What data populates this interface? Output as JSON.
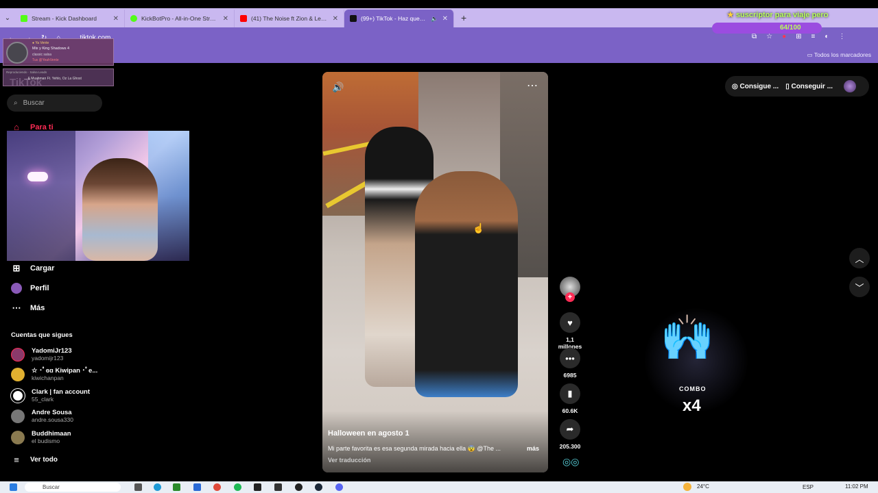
{
  "browser": {
    "tabs": [
      {
        "title": "Stream - Kick Dashboard",
        "color": "#53fc18"
      },
      {
        "title": "KickBotPro - All-in-One Stream...",
        "color": "#53fc18"
      },
      {
        "title": "(41) The Noise ft Zion & Lennox ...",
        "color": "#ff0000"
      },
      {
        "title": "(99+) TikTok - Haz que tu d...",
        "color": "#111111"
      }
    ],
    "new_tab": "+",
    "url": "tiktok.com",
    "bookmarks_all": "Todos los marcadores"
  },
  "overlay": {
    "sub_goal": "suscriptor para viaje pero",
    "goal_progress": "64/100",
    "music_l1": "● Ya Vente",
    "music_l2": "Mix y King Shadows 4",
    "music_l3": "classic salsa",
    "music_l4": "Tus @YeahVente",
    "music2_l1": "Reproduciendo · Salsa Leads",
    "music2_l2": "... & Mushman Ft. Yehlo, Oz La Ghost",
    "combo_label": "COMBO",
    "combo_count": "x4"
  },
  "sidebar": {
    "logo": "TikTok",
    "search_placeholder": "Buscar",
    "nav": {
      "for_you": "Para ti",
      "upload": "Cargar",
      "profile": "Perfil",
      "more": "Más"
    },
    "following_title": "Cuentas que sigues",
    "following": [
      {
        "name": "YadomiJr123",
        "handle": "yadomijr123",
        "color": "#8a3a6a"
      },
      {
        "name": "☆ ･ﾟɞɑ Kiwipan ･ﾟe...",
        "handle": "kiwichanpan",
        "color": "#e0b030"
      },
      {
        "name": "Clark | fan account",
        "handle": "55_clark",
        "color": "#ffffff"
      },
      {
        "name": "Andre Sousa",
        "handle": "andre.sousa330",
        "color": "#777777"
      },
      {
        "name": "Buddhimaan",
        "handle": "el budismo",
        "color": "#8a7a50"
      }
    ],
    "see_all": "Ver todo"
  },
  "video": {
    "title": "Halloween en agosto 1",
    "description": "Mi parte favorita es esa segunda mirada hacia ella 😨 @The ...",
    "more": "más",
    "translate": "Ver traducción"
  },
  "actions": {
    "likes": "1,1 millones",
    "comments": "6985",
    "saves": "60.6K",
    "shares": "205.300"
  },
  "topbar": {
    "get_coins": "Consigue ...",
    "get_app": "Conseguir ..."
  },
  "taskbar": {
    "search": "Buscar",
    "weather": "24°C",
    "lang": "ESP",
    "time": "11:02 PM"
  },
  "colors": {
    "accent": "#fe2c55",
    "chrome": "#7b62c6",
    "goal_text": "#b8ff5a"
  }
}
